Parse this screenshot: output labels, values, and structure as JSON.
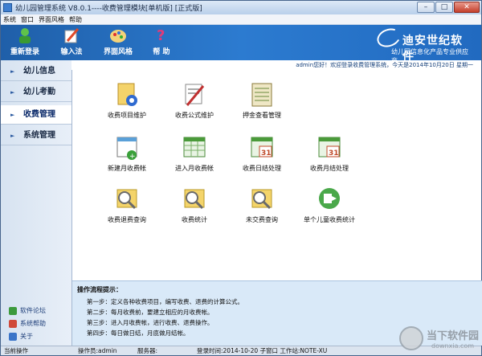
{
  "window": {
    "title": "幼儿园管理系统 V8.0.1----收费管理模块[单机版] [正式版]",
    "min": "–",
    "max": "□",
    "close": "✕"
  },
  "menu": [
    "系统",
    "窗口",
    "界面风格",
    "帮助"
  ],
  "toolbar": [
    {
      "label": "重新登录",
      "icon": "re-login-icon"
    },
    {
      "label": "输入法",
      "icon": "input-method-icon"
    },
    {
      "label": "界面风格",
      "icon": "ui-style-icon"
    },
    {
      "label": "帮 助",
      "icon": "help-icon"
    }
  ],
  "brand": {
    "name": "迪安世纪软件",
    "slogan": "幼儿园信息化产品专业供应商",
    "small": "SCIWORLD"
  },
  "welcome": "admin您好！欢迎登录收费管理系统，今天是2014年10月20日  星期一",
  "sidebar": {
    "items": [
      "幼儿信息",
      "幼儿考勤",
      "收费管理",
      "系统管理"
    ],
    "footer": [
      "软件论坛",
      "系统帮助",
      "关于"
    ]
  },
  "main": {
    "row1": [
      "收费项目维护",
      "收费公式维护",
      "押金查看管理"
    ],
    "row2": [
      "新建月收费帐",
      "进入月收费帐",
      "收费日结处理",
      "收费月结处理"
    ],
    "row3": [
      "收费退费查询",
      "收费统计",
      "未交费查询",
      "单个儿童收费统计"
    ]
  },
  "tips": {
    "title": "操作流程提示：",
    "lines": [
      "第一步：定义各种收费项目，编写收费、退费的计算公式。",
      "第二步：每月收费前，要建立相应的月收费帐。",
      "第三步：进入月收费帐，进行收费、退费操作。",
      "第四步：每日做日结，月底做月结帐。"
    ]
  },
  "status": {
    "op": "当前操作",
    "operator": "操作员:admin",
    "server": "服务器:",
    "login": "登录时间:2014-10-20 子窗口 工作站:NOTE-XU"
  },
  "watermark": {
    "title": "当下软件园",
    "url": "downxia.com"
  }
}
